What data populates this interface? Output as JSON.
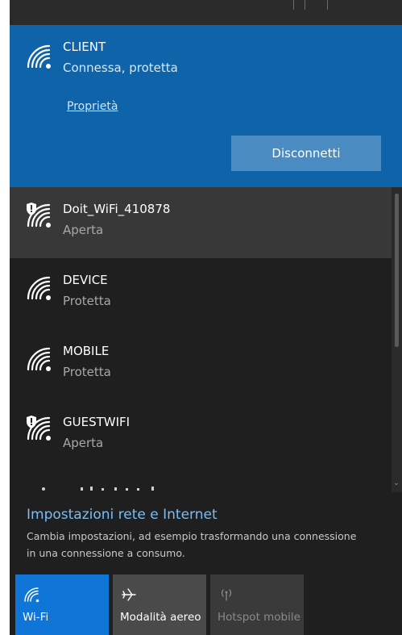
{
  "networks": {
    "connected": {
      "name": "CLIENT",
      "status": "Connessa, protetta",
      "properties_label": "Proprietà",
      "disconnect_label": "Disconnetti",
      "icon": "wifi-signal-icon"
    },
    "list": [
      {
        "name": "Doit_WiFi_410878",
        "status": "Aperta",
        "icon": "wifi-open-shield-icon"
      },
      {
        "name": "DEVICE",
        "status": "Protetta",
        "icon": "wifi-signal-icon"
      },
      {
        "name": "MOBILE",
        "status": "Protetta",
        "icon": "wifi-signal-icon"
      },
      {
        "name": "GUESTWIFI",
        "status": "Aperta",
        "icon": "wifi-open-shield-icon"
      }
    ]
  },
  "footer": {
    "settings_link": "Impostazioni rete e Internet",
    "settings_desc": "Cambia impostazioni, ad esempio trasformando una connessione in una connessione a consumo.",
    "tiles": [
      {
        "label": "Wi-Fi",
        "icon": "wifi-icon",
        "state": "on"
      },
      {
        "label": "Modalità aereo",
        "icon": "airplane-icon",
        "state": "off"
      },
      {
        "label": "Hotspot mobile",
        "icon": "hotspot-icon",
        "state": "disabled"
      }
    ]
  },
  "colors": {
    "accent": "#0f63a8",
    "panel": "#1f1f1f",
    "link": "#7dbcf2",
    "tile_active": "#0f75d6"
  }
}
